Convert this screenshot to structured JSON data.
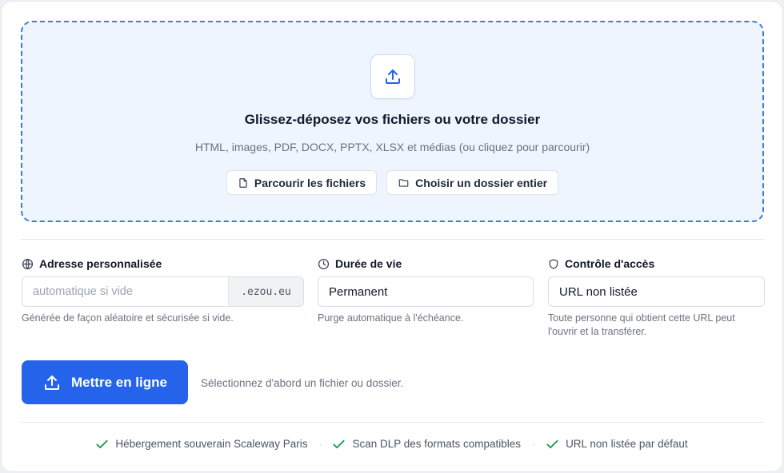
{
  "dropzone": {
    "title": "Glissez-déposez vos fichiers ou votre dossier",
    "subtitle": "HTML, images, PDF, DOCX, PPTX, XLSX et médias (ou cliquez pour parcourir)",
    "browse_files_label": "Parcourir les fichiers",
    "choose_folder_label": "Choisir un dossier entier",
    "upload_icon": "upload-icon"
  },
  "address": {
    "label": "Adresse personnalisée",
    "placeholder": "automatique si vide",
    "suffix": ".ezou.eu",
    "help": "Générée de façon aléatoire et sécurisée si vide.",
    "icon": "globe-icon"
  },
  "lifetime": {
    "label": "Durée de vie",
    "value": "Permanent",
    "help": "Purge automatique à l'échéance.",
    "icon": "clock-icon"
  },
  "access": {
    "label": "Contrôle d'accès",
    "value": "URL non listée",
    "help": "Toute personne qui obtient cette URL peut l'ouvrir et la transférer.",
    "icon": "shield-icon"
  },
  "submit": {
    "label": "Mettre en ligne",
    "status": "Sélectionnez d'abord un fichier ou dossier."
  },
  "features": [
    "Hébergement souverain Scaleway Paris",
    "Scan DLP des formats compatibles",
    "URL non listée par défaut"
  ],
  "colors": {
    "accent": "#2563eb",
    "dropzone_bg": "#eef5ff",
    "dropzone_border": "#3b7bdc",
    "check": "#1f9d55"
  }
}
